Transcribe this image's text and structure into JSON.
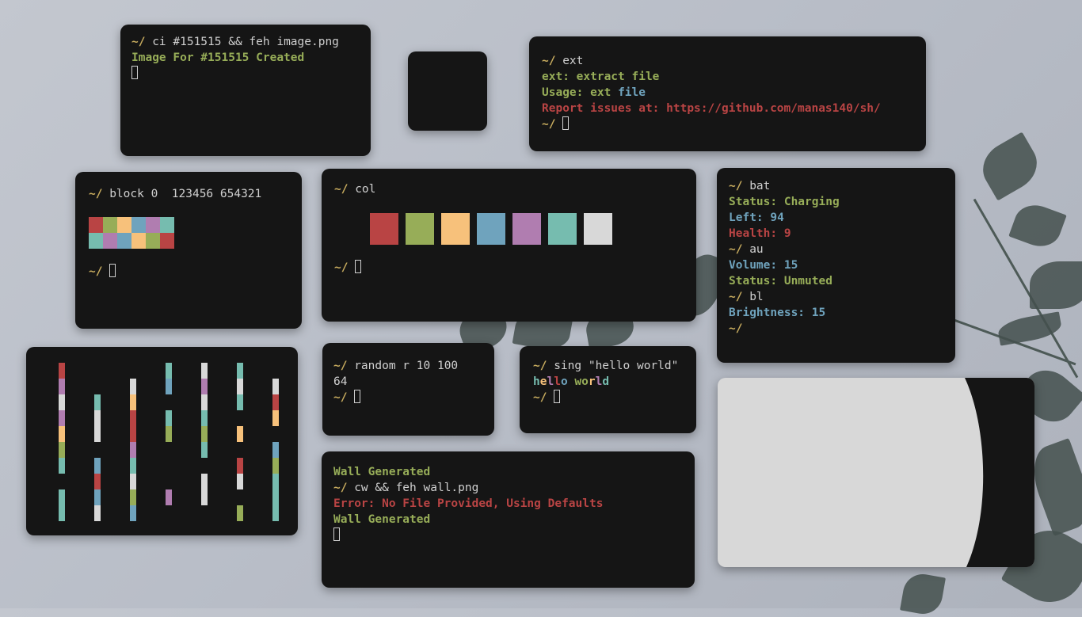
{
  "prompt": "~/",
  "colors": {
    "bg": "#151515",
    "red": "#b94444",
    "green": "#97ad58",
    "yellow": "#f7c17b",
    "blue": "#6fa3bd",
    "magenta": "#b07db0",
    "cyan": "#76bcaf",
    "white": "#d8d8d8"
  },
  "w1": {
    "cmd": "ci #151515 && feh image.png",
    "out": "Image For #151515 Created"
  },
  "w3": {
    "cmd": "ext",
    "l1_label": "ext:",
    "l1_rest": "extract file",
    "l2_label": "Usage:",
    "l2_cmd": "ext",
    "l2_arg": "file",
    "l3": "Report issues at: https://github.com/manas140/sh/"
  },
  "w4": {
    "cmd": "block 0  123456 654321"
  },
  "w5": {
    "cmd": "col"
  },
  "w6": {
    "cmd1": "bat",
    "status_label": "Status:",
    "status_value": "Charging",
    "left_label": "Left:",
    "left_value": "94",
    "health_label": "Health:",
    "health_value": "9",
    "cmd2": "au",
    "volume_label": "Volume:",
    "volume_value": "15",
    "au_status_label": "Status:",
    "au_status_value": "Unmuted",
    "cmd3": "bl",
    "bright_label": "Brightness:",
    "bright_value": "15"
  },
  "w8": {
    "cmd": "random r 10 100",
    "out": "64"
  },
  "w9": {
    "cmd": "sing \"hello world\"",
    "out_letters": [
      "h",
      "e",
      "l",
      "l",
      "o",
      " ",
      "w",
      "o",
      "r",
      "l",
      "d"
    ]
  },
  "w10": {
    "l1": "Wall Generated",
    "cmd": "cw && feh wall.png",
    "err": "Error: No File Provided, Using Defaults",
    "l4": "Wall Generated"
  }
}
